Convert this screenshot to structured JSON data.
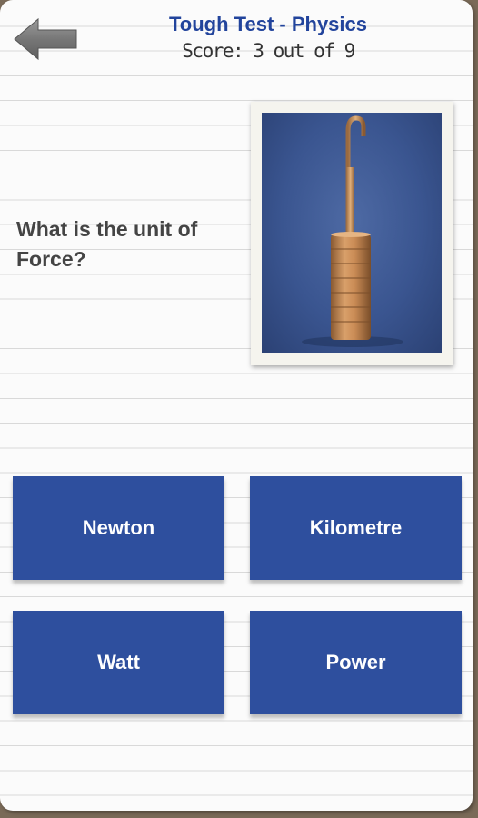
{
  "header": {
    "title": "Tough Test - Physics",
    "score": "Score: 3 out of 9",
    "back_icon": "back-arrow-icon"
  },
  "question": {
    "text": "What is the unit of Force?",
    "image": "hanging-mass-weight-photo"
  },
  "answers": [
    {
      "label": "Newton"
    },
    {
      "label": "Kilometre"
    },
    {
      "label": "Watt"
    },
    {
      "label": "Power"
    }
  ],
  "colors": {
    "accent": "#2e4f9e",
    "title": "#22449c"
  }
}
